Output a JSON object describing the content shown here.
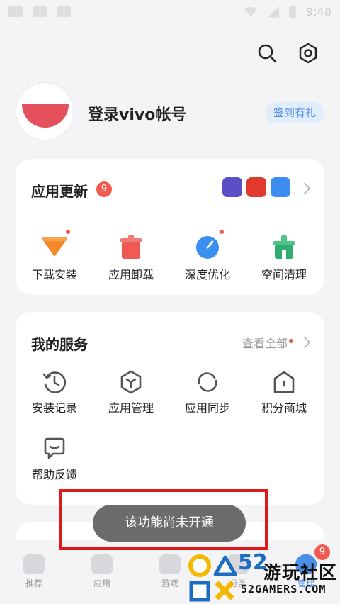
{
  "status_bar": {
    "time": "9:48"
  },
  "header": {
    "search_icon": "search-icon",
    "settings_icon": "gear-icon"
  },
  "profile": {
    "login_label": "登录vivo帐号",
    "checkin_label": "签到有礼"
  },
  "app_update": {
    "title": "应用更新",
    "badge": "9",
    "mini_apps": [
      "#5a4fc4",
      "#e03a2f",
      "#3d8cf0"
    ],
    "tools": [
      {
        "label": "下载安装",
        "icon": "download-icon",
        "color": "#f5872a",
        "dot": true
      },
      {
        "label": "应用卸载",
        "icon": "trash-icon",
        "color": "#ef5a55",
        "dot": false
      },
      {
        "label": "深度优化",
        "icon": "gauge-icon",
        "color": "#3a8ff0",
        "dot": true
      },
      {
        "label": "空间清理",
        "icon": "broom-icon",
        "color": "#2fae6f",
        "dot": false
      }
    ]
  },
  "my_services": {
    "title": "我的服务",
    "see_all": "查看全部",
    "items": [
      {
        "label": "安装记录",
        "icon": "history-icon"
      },
      {
        "label": "应用管理",
        "icon": "hexagon-icon"
      },
      {
        "label": "应用同步",
        "icon": "sync-icon"
      },
      {
        "label": "积分商城",
        "icon": "house-icon"
      },
      {
        "label": "帮助反馈",
        "icon": "feedback-icon"
      }
    ]
  },
  "bottom_nav": {
    "tabs": [
      {
        "label": "推荐",
        "active": false
      },
      {
        "label": "应用",
        "active": false
      },
      {
        "label": "游戏",
        "active": false
      },
      {
        "label": "分类",
        "active": false
      },
      {
        "label": "管理",
        "active": true
      }
    ],
    "badge": "9"
  },
  "toast": {
    "text": "该功能尚未开通"
  },
  "watermark": {
    "num": "52",
    "cn": "游玩社区",
    "en": "52GAMERS.COM"
  },
  "colors": {
    "accent": "#4a8fe8",
    "badge": "#f05a50",
    "frame": "#e0191b"
  }
}
